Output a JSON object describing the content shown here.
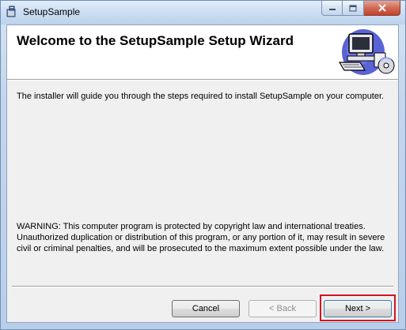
{
  "window": {
    "title": "SetupSample",
    "icon": "installer-icon"
  },
  "caption_buttons": {
    "minimize_icon": "minimize-icon",
    "maximize_icon": "maximize-icon",
    "close_icon": "close-icon"
  },
  "header": {
    "title": "Welcome to the SetupSample Setup Wizard",
    "banner_image": "computer-setup-icon"
  },
  "body": {
    "intro": "The installer will guide you through the steps required to install SetupSample on your computer.",
    "warning": "WARNING: This computer program is protected by copyright law and international treaties. Unauthorized duplication or distribution of this program, or any portion of it, may result in severe civil or criminal penalties, and will be prosecuted to the maximum extent possible under the law."
  },
  "buttons": {
    "cancel": "Cancel",
    "back": "< Back",
    "next": "Next >"
  },
  "colors": {
    "highlight": "#d11522",
    "next_focus_border": "#3c7fb1"
  }
}
